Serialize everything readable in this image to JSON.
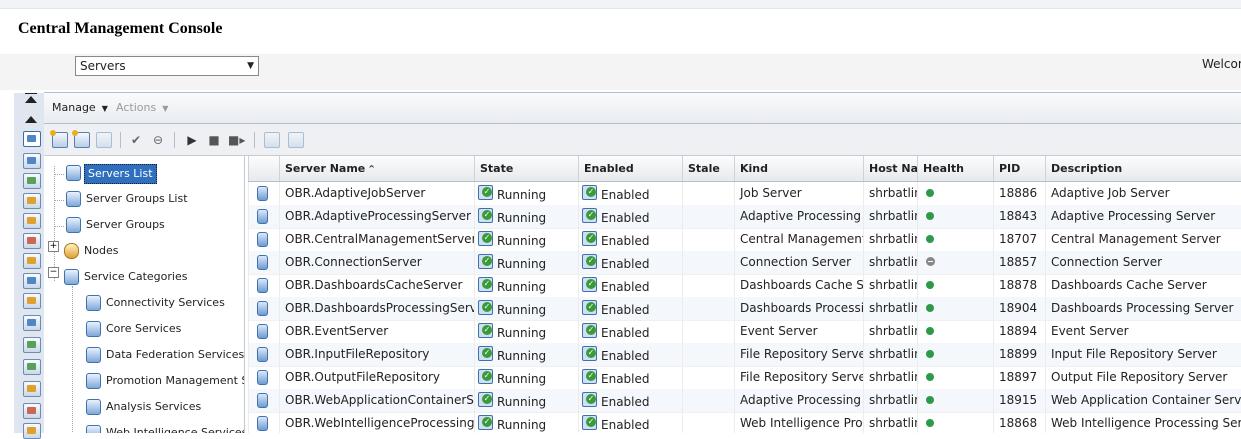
{
  "app": {
    "title": "Central Management Console",
    "welcome": "Welcome"
  },
  "nav_select": {
    "value": "Servers"
  },
  "menubar": {
    "manage": "Manage",
    "actions": "Actions"
  },
  "tree": {
    "nodes": [
      {
        "label": "Servers List",
        "selected": true
      },
      {
        "label": "Server Groups List"
      },
      {
        "label": "Server Groups"
      },
      {
        "label": "Nodes",
        "expander": "+"
      },
      {
        "label": "Service Categories",
        "expander": "−"
      },
      {
        "label": "Connectivity Services"
      },
      {
        "label": "Core Services"
      },
      {
        "label": "Data Federation Services"
      },
      {
        "label": "Promotion Management Services"
      },
      {
        "label": "Analysis Services"
      },
      {
        "label": "Web Intelligence Services"
      }
    ]
  },
  "table": {
    "columns": [
      "Server Name",
      "State",
      "Enabled",
      "Stale",
      "Kind",
      "Host Name",
      "Health",
      "PID",
      "Description"
    ],
    "sort_indicator": "^",
    "rows": [
      {
        "name": "OBR.AdaptiveJobServer",
        "state": "Running",
        "enabled": "Enabled",
        "stale": "",
        "kind": "Job Server",
        "host": "shrbatlin",
        "health": "green",
        "pid": "18886",
        "description": "Adaptive Job Server"
      },
      {
        "name": "OBR.AdaptiveProcessingServer",
        "state": "Running",
        "enabled": "Enabled",
        "stale": "",
        "kind": "Adaptive Processing Server",
        "host": "shrbatlin",
        "health": "green",
        "pid": "18843",
        "description": "Adaptive Processing Server"
      },
      {
        "name": "OBR.CentralManagementServer",
        "state": "Running",
        "enabled": "Enabled",
        "stale": "",
        "kind": "Central Management Server",
        "host": "shrbatlin",
        "health": "green",
        "pid": "18707",
        "description": "Central Management Server"
      },
      {
        "name": "OBR.ConnectionServer",
        "state": "Running",
        "enabled": "Enabled",
        "stale": "",
        "kind": "Connection Server",
        "host": "shrbatlin",
        "health": "gray",
        "pid": "18857",
        "description": "Connection Server"
      },
      {
        "name": "OBR.DashboardsCacheServer",
        "state": "Running",
        "enabled": "Enabled",
        "stale": "",
        "kind": "Dashboards Cache Server",
        "host": "shrbatlin",
        "health": "green",
        "pid": "18878",
        "description": "Dashboards Cache Server"
      },
      {
        "name": "OBR.DashboardsProcessingServer",
        "state": "Running",
        "enabled": "Enabled",
        "stale": "",
        "kind": "Dashboards Processing Server",
        "host": "shrbatlin",
        "health": "green",
        "pid": "18904",
        "description": "Dashboards Processing Server"
      },
      {
        "name": "OBR.EventServer",
        "state": "Running",
        "enabled": "Enabled",
        "stale": "",
        "kind": "Event Server",
        "host": "shrbatlin",
        "health": "green",
        "pid": "18894",
        "description": "Event Server"
      },
      {
        "name": "OBR.InputFileRepository",
        "state": "Running",
        "enabled": "Enabled",
        "stale": "",
        "kind": "File Repository Server",
        "host": "shrbatlin",
        "health": "green",
        "pid": "18899",
        "description": "Input File Repository Server"
      },
      {
        "name": "OBR.OutputFileRepository",
        "state": "Running",
        "enabled": "Enabled",
        "stale": "",
        "kind": "File Repository Server",
        "host": "shrbatlin",
        "health": "green",
        "pid": "18897",
        "description": "Output File Repository Server"
      },
      {
        "name": "OBR.WebApplicationContainerServer",
        "state": "Running",
        "enabled": "Enabled",
        "stale": "",
        "kind": "Adaptive Processing Server",
        "host": "shrbatlin",
        "health": "green",
        "pid": "18915",
        "description": "Web Application Container Server"
      },
      {
        "name": "OBR.WebIntelligenceProcessingServer",
        "state": "Running",
        "enabled": "Enabled",
        "stale": "",
        "kind": "Web Intelligence Processing Server",
        "host": "shrbatlin",
        "health": "green",
        "pid": "18868",
        "description": "Web Intelligence Processing Server"
      }
    ]
  },
  "colors": {
    "selection": "#2f6fbe",
    "health_ok": "#2e9a48",
    "health_unknown": "#888888",
    "row_alt": "#f4f7fb"
  }
}
